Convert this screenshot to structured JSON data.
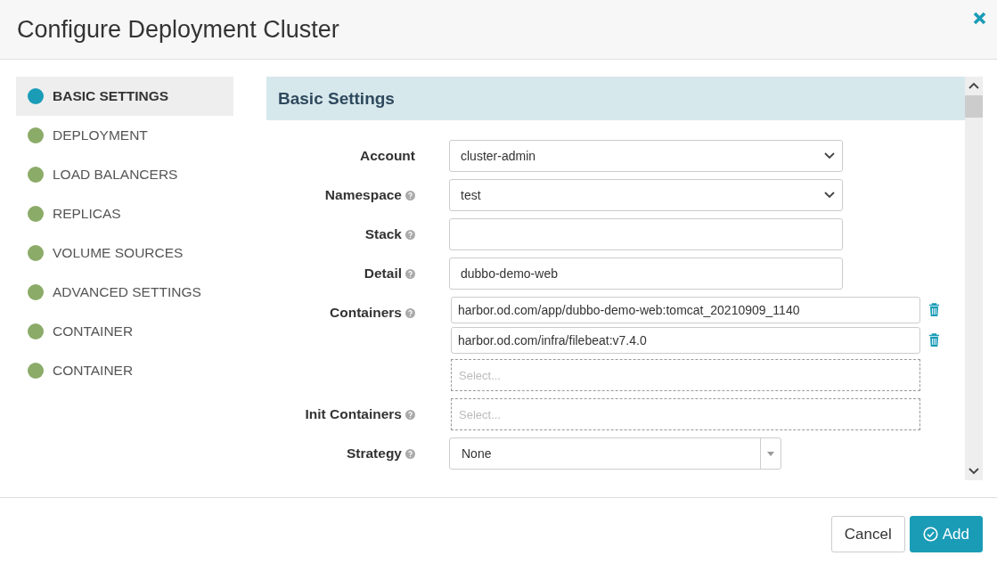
{
  "window": {
    "title": "Configure Deployment Cluster"
  },
  "sidebar": {
    "items": [
      {
        "label": "BASIC SETTINGS",
        "selected": true,
        "color": "#1a9cb7"
      },
      {
        "label": "DEPLOYMENT",
        "selected": false,
        "color": "#8bab68"
      },
      {
        "label": "LOAD BALANCERS",
        "selected": false,
        "color": "#8bab68"
      },
      {
        "label": "REPLICAS",
        "selected": false,
        "color": "#8bab68"
      },
      {
        "label": "VOLUME SOURCES",
        "selected": false,
        "color": "#8bab68"
      },
      {
        "label": "ADVANCED SETTINGS",
        "selected": false,
        "color": "#8bab68"
      },
      {
        "label": "CONTAINER",
        "selected": false,
        "color": "#8bab68"
      },
      {
        "label": "CONTAINER",
        "selected": false,
        "color": "#8bab68"
      }
    ]
  },
  "section": {
    "title": "Basic Settings"
  },
  "fields": [
    {
      "label": "Account",
      "help": false,
      "kind": "select",
      "value": "cluster-admin"
    },
    {
      "label": "Namespace",
      "help": true,
      "kind": "select",
      "value": "test"
    },
    {
      "label": "Stack",
      "help": true,
      "kind": "input"
    },
    {
      "label": "Detail",
      "help": true,
      "kind": "input",
      "value": "dubbo-demo-web"
    },
    {
      "label": "Containers",
      "help": true,
      "kind": "list",
      "items": [
        "harbor.od.com/app/dubbo-demo-web:tomcat_20210909_1140",
        "harbor.od.com/infra/filebeat:v7.4.0"
      ],
      "placeholder": "Select..."
    },
    {
      "label": "Init Containers",
      "help": true,
      "kind": "multi",
      "placeholder": "Select..."
    },
    {
      "label": "Strategy",
      "help": true,
      "kind": "combo",
      "value": "None"
    }
  ],
  "buttons": [
    {
      "label": "Cancel",
      "kind": "secondary"
    },
    {
      "label": "Add",
      "kind": "primary"
    }
  ]
}
